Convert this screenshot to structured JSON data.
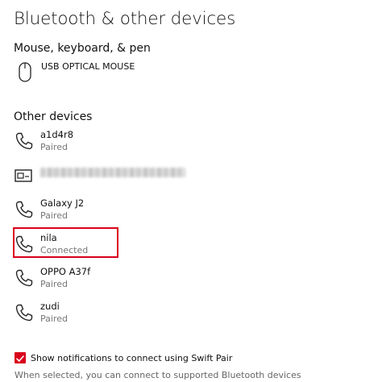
{
  "page": {
    "title": "Bluetooth & other devices"
  },
  "sections": {
    "mouse_keyboard_pen": {
      "title": "Mouse, keyboard, & pen",
      "items": [
        {
          "name": "USB OPTICAL MOUSE",
          "icon": "mouse-icon"
        }
      ]
    },
    "other_devices": {
      "title": "Other devices",
      "items": [
        {
          "name": "a1d4r8",
          "status": "Paired",
          "icon": "phone-icon"
        },
        {
          "name": "",
          "status": "",
          "icon": "display-device-icon",
          "name_redacted": true
        },
        {
          "name": "Galaxy J2",
          "status": "Paired",
          "icon": "phone-icon"
        },
        {
          "name": "nila",
          "status": "Connected",
          "icon": "phone-icon",
          "highlighted": true
        },
        {
          "name": "OPPO A37f",
          "status": "Paired",
          "icon": "phone-icon"
        },
        {
          "name": "zudi",
          "status": "Paired",
          "icon": "phone-icon"
        }
      ]
    }
  },
  "swift_pair": {
    "checked": true,
    "label": "Show notifications to connect using Swift Pair",
    "helper": "When selected, you can connect to supported Bluetooth devices"
  },
  "colors": {
    "accent": "#d9001b",
    "highlight_border": "#d9001b",
    "status_text": "#767676"
  }
}
